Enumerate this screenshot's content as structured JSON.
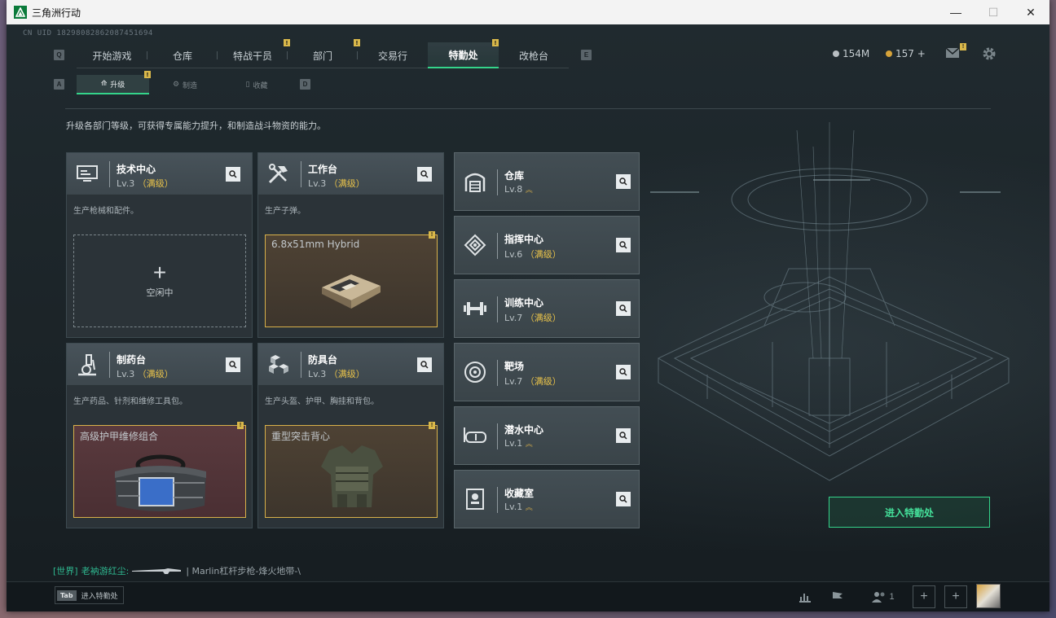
{
  "window": {
    "title": "三角洲行动"
  },
  "uid": "CN UID 18298082862087451694",
  "nav": {
    "left_key": "Q",
    "right_key": "E",
    "tabs": [
      {
        "label": "开始游戏",
        "badge": false,
        "active": false
      },
      {
        "label": "仓库",
        "badge": false,
        "active": false
      },
      {
        "label": "特战干员",
        "badge": true,
        "active": false
      },
      {
        "label": "部门",
        "badge": true,
        "active": false
      },
      {
        "label": "交易行",
        "badge": false,
        "active": false
      },
      {
        "label": "特勤处",
        "badge": true,
        "active": true
      },
      {
        "label": "改枪台",
        "badge": false,
        "active": false
      }
    ]
  },
  "currency": {
    "silver": "154M",
    "gold": "157 +"
  },
  "subnav": {
    "left_key": "A",
    "right_key": "D",
    "tabs": [
      {
        "label": "升级",
        "active": true
      },
      {
        "label": "制造",
        "active": false
      },
      {
        "label": "收藏",
        "active": false
      }
    ]
  },
  "description": "升级各部门等级，可获得专属能力提升，和制造战斗物资的能力。",
  "cards": [
    {
      "name": "技术中心",
      "level": "Lv.3",
      "max": "（满级）",
      "icon": "monitor-icon",
      "desc": "生产枪械和配件。",
      "slot": {
        "state": "idle",
        "label": "空闲中",
        "plus": "+"
      }
    },
    {
      "name": "工作台",
      "level": "Lv.3",
      "max": "（满级）",
      "icon": "tools-icon",
      "desc": "生产子弹。",
      "slot": {
        "state": "item",
        "label": "6.8x51mm Hybrid",
        "badge": "!"
      }
    },
    {
      "name": "制药台",
      "level": "Lv.3",
      "max": "（满级）",
      "icon": "microscope-icon",
      "desc": "生产药品、针剂和维修工具包。",
      "slot": {
        "state": "item",
        "label": "高级护甲维修组合",
        "badge": "!"
      }
    },
    {
      "name": "防具台",
      "level": "Lv.3",
      "max": "（满级）",
      "icon": "cubes-icon",
      "desc": "生产头盔、护甲、胸挂和背包。",
      "slot": {
        "state": "item",
        "label": "重型突击背心",
        "badge": "!"
      }
    }
  ],
  "facilities": [
    {
      "name": "仓库",
      "level": "Lv.8",
      "max": "",
      "up": "︽",
      "icon": "warehouse-icon"
    },
    {
      "name": "指挥中心",
      "level": "Lv.6",
      "max": "（满级）",
      "up": "",
      "icon": "command-icon"
    },
    {
      "name": "训练中心",
      "level": "Lv.7",
      "max": "（满级）",
      "up": "",
      "icon": "dumbbell-icon"
    },
    {
      "name": "靶场",
      "level": "Lv.7",
      "max": "（满级）",
      "up": "",
      "icon": "target-icon"
    },
    {
      "name": "潜水中心",
      "level": "Lv.1",
      "max": "",
      "up": "︽",
      "icon": "goggles-icon"
    },
    {
      "name": "收藏室",
      "level": "Lv.1",
      "max": "",
      "up": "︽",
      "icon": "collection-icon"
    }
  ],
  "enter_button": "进入特勤处",
  "chat": {
    "channel": "[世界]",
    "sender": "老衲游红尘:",
    "message": "| Marlin杠杆步枪-烽火地带-\\"
  },
  "bottom": {
    "tab_key": "Tab",
    "tab_label": "进入特勤处",
    "friends_count": "1"
  },
  "colors": {
    "accent": "#34d48a",
    "max_level": "#e8c24a",
    "badge": "#d9b84a"
  }
}
